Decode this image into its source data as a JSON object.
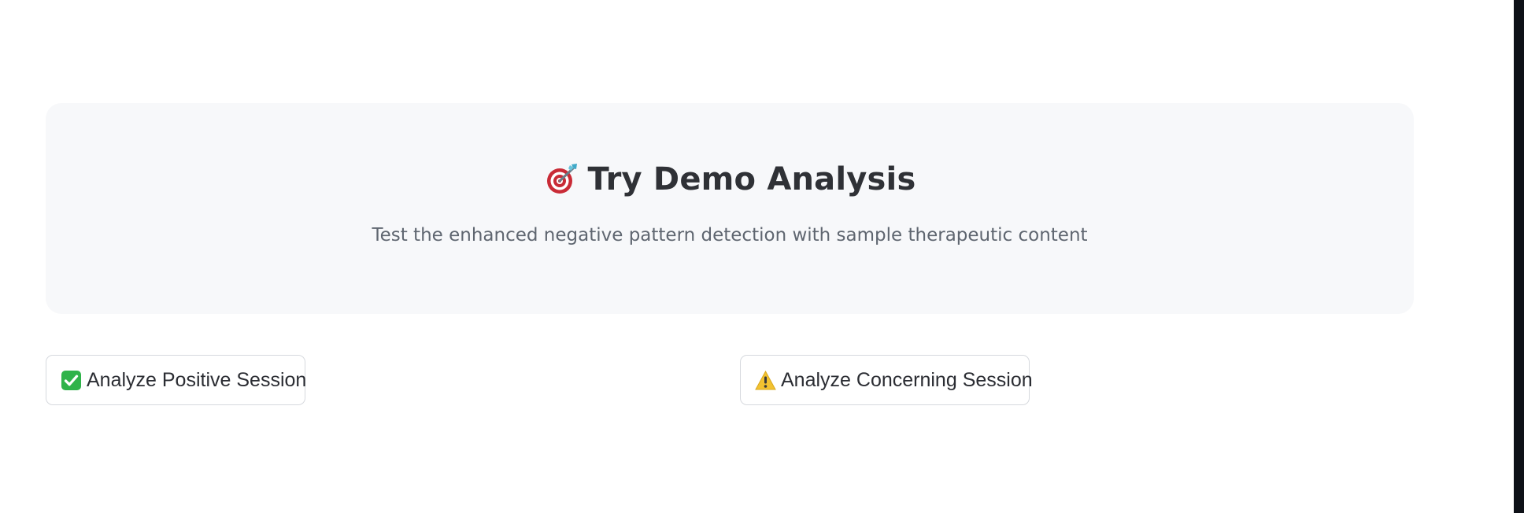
{
  "demo": {
    "title": "Try Demo Analysis",
    "title_icon": "target-dart-icon",
    "subtitle": "Test the enhanced negative pattern detection with sample therapeutic content"
  },
  "actions": {
    "positive": {
      "label": "Analyze Positive Session",
      "icon": "check-mark-icon"
    },
    "concerning": {
      "label": "Analyze Concerning Session",
      "icon": "warning-icon"
    }
  },
  "colors": {
    "card_background": "#f7f8fa",
    "check_green": "#2fb34a",
    "warning_yellow": "#f2c230",
    "target_red": "#c92b36"
  }
}
